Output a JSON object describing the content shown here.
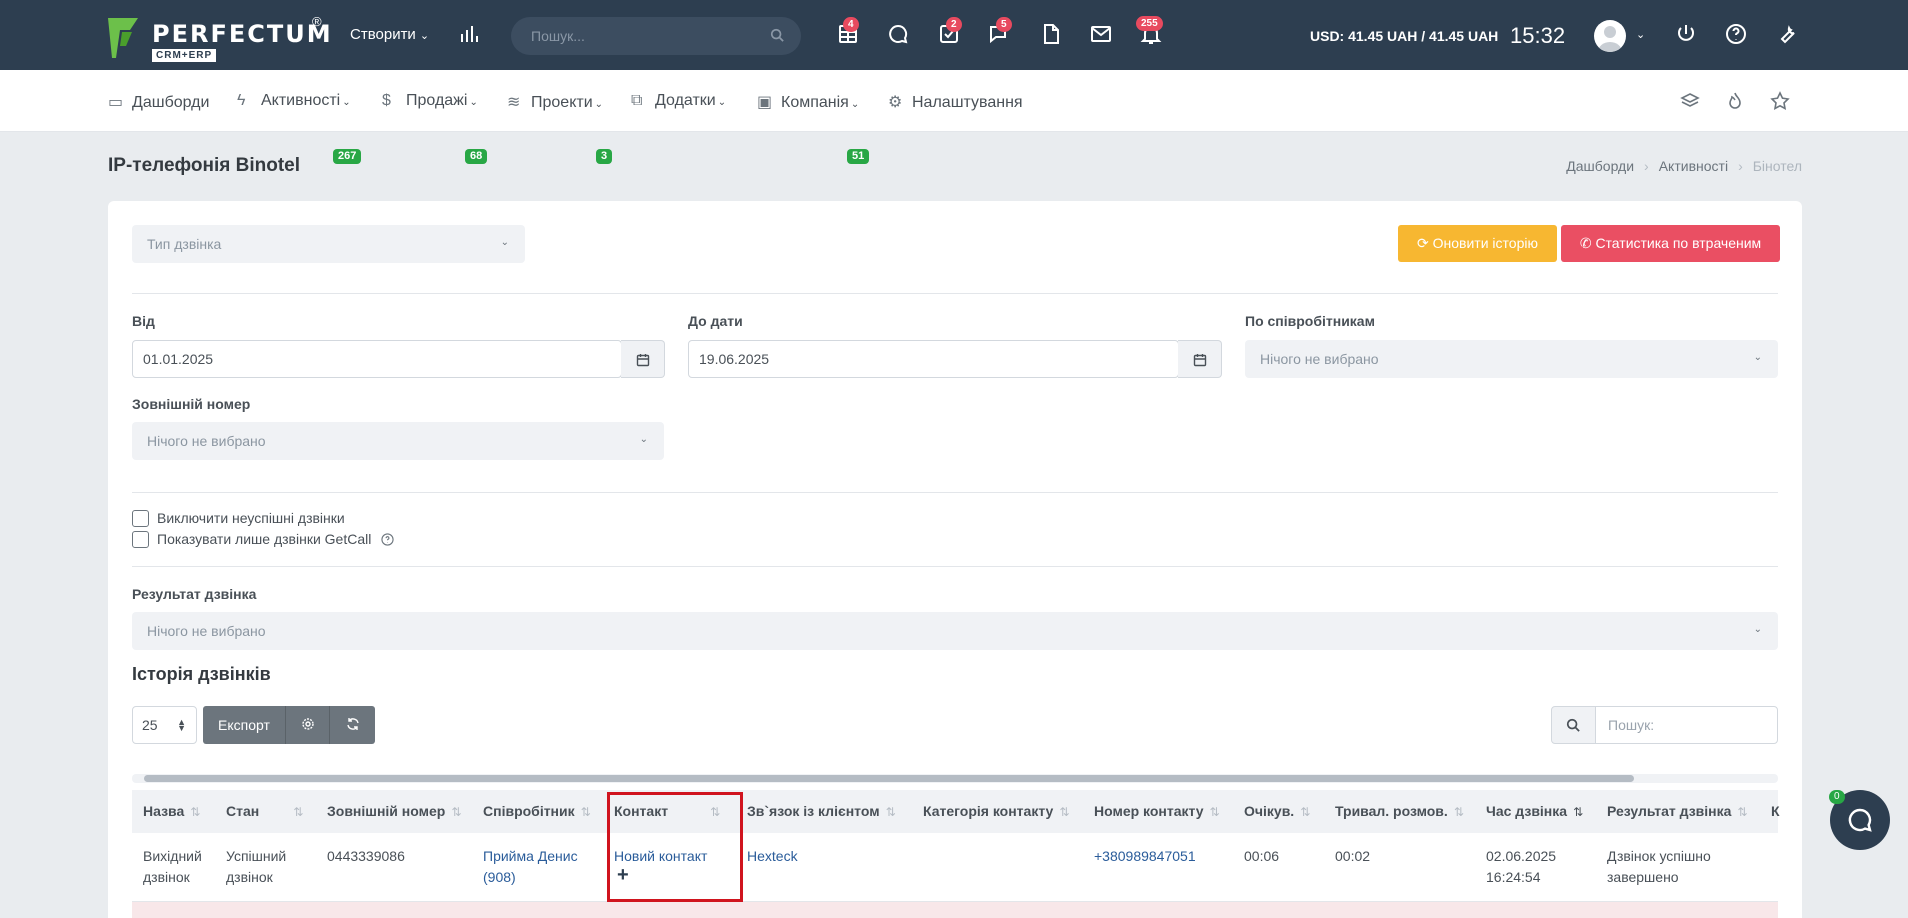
{
  "topbar": {
    "logo_text": "PERFECTUM",
    "logo_reg": "®",
    "logo_sub": "CRM+ERP",
    "create_label": "Створити",
    "search_placeholder": "Пошук...",
    "badges": {
      "tables": "4",
      "tasks": "2",
      "chat": "5",
      "notifications": "255"
    },
    "currency": "USD: 41.45 UAH / 41.45 UAH",
    "clock": "15:32"
  },
  "nav": {
    "items": [
      {
        "label": "Дашборди"
      },
      {
        "label": "Активності",
        "badge": "267"
      },
      {
        "label": "Продажі",
        "badge": "68"
      },
      {
        "label": "Проекти",
        "badge": "3"
      },
      {
        "label": "Додатки"
      },
      {
        "label": "Компанія",
        "badge": "51"
      },
      {
        "label": "Налаштування"
      }
    ]
  },
  "page": {
    "title": "IP-телефонія Binotel",
    "breadcrumb": [
      "Дашборди",
      "Активності",
      "Бінотел"
    ]
  },
  "filters": {
    "call_type_placeholder": "Тип дзвінка",
    "refresh_history": "Оновити історію",
    "missed_stats": "Статистика по втраченим",
    "from_label": "Від",
    "from_value": "01.01.2025",
    "to_label": "До дати",
    "to_value": "19.06.2025",
    "employees_label": "По співробітникам",
    "employees_placeholder": "Нічого не вибрано",
    "external_label": "Зовнішній номер",
    "external_placeholder": "Нічого не вибрано",
    "exclude_failed": "Виключити неуспішні дзвінки",
    "only_getcall": "Показувати лише дзвінки GetCall",
    "result_label": "Результат дзвінка",
    "result_placeholder": "Нічого не вибрано"
  },
  "history": {
    "title": "Історія дзвінків",
    "page_size": "25",
    "export_label": "Експорт",
    "search_placeholder": "Пошук:",
    "columns": [
      "Назва",
      "Стан",
      "Зовнішній номер",
      "Співробітник",
      "Контакт",
      "Зв`язок із клієнтом",
      "Категорія контакту",
      "Номер контакту",
      "Очікув.",
      "Тривал. розмов.",
      "Час дзвінка",
      "Результат дзвінка",
      "К"
    ],
    "rows": [
      {
        "name": "Вихідний дзвінок",
        "status": "Успішний дзвінок",
        "external": "0443339086",
        "employee": "Прийма Денис (908)",
        "contact": "Новий контакт",
        "client": "Hexteck",
        "category": "",
        "phone": "+380989847051",
        "wait": "00:06",
        "duration": "00:02",
        "time": "02.06.2025 16:24:54",
        "result": "Дзвінок успішно завершено"
      }
    ]
  },
  "chat_badge": "0"
}
